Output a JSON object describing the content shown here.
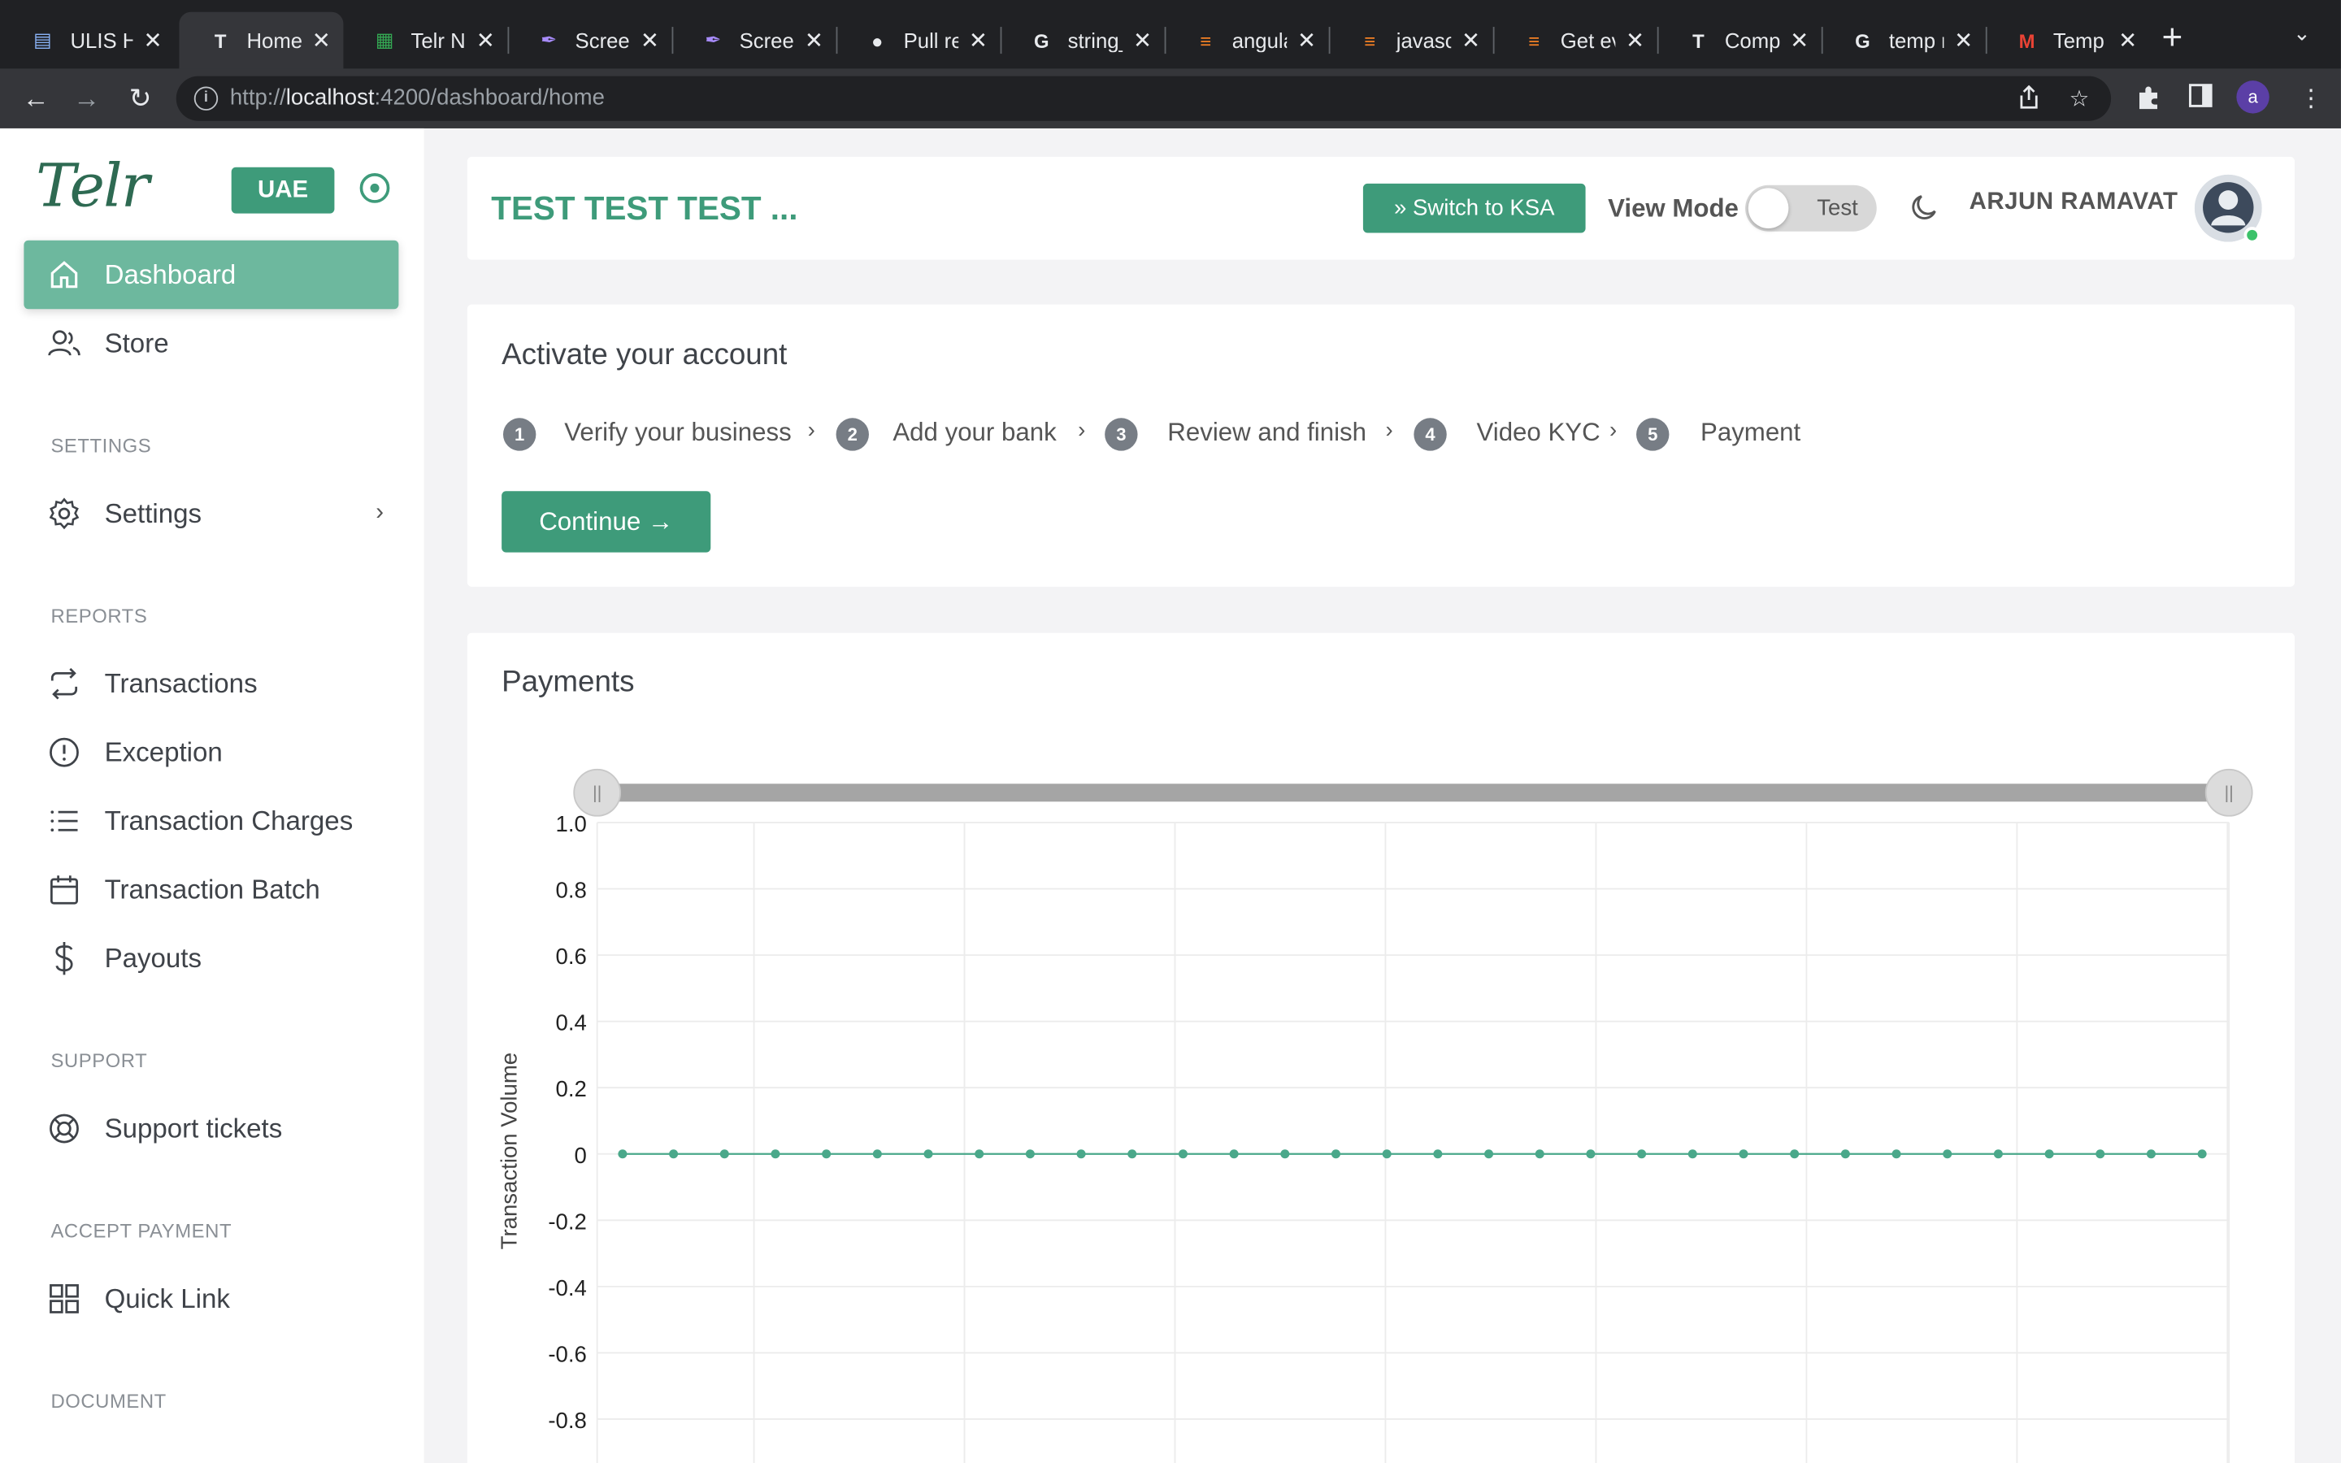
{
  "browser": {
    "tabs": [
      {
        "label": "ULIS H",
        "icon": "document-icon"
      },
      {
        "label": "Home",
        "icon": "telr-icon",
        "active": true
      },
      {
        "label": "Telr Ne",
        "icon": "sheets-icon"
      },
      {
        "label": "Screen",
        "icon": "feather-icon"
      },
      {
        "label": "Screen",
        "icon": "feather-icon"
      },
      {
        "label": "Pull re",
        "icon": "github-icon"
      },
      {
        "label": "string_",
        "icon": "google-icon"
      },
      {
        "label": "angula",
        "icon": "stackoverflow-icon"
      },
      {
        "label": "javasc",
        "icon": "stackoverflow-icon"
      },
      {
        "label": "Get ev",
        "icon": "stackoverflow-icon"
      },
      {
        "label": "Compl",
        "icon": "telr-icon"
      },
      {
        "label": "temp r",
        "icon": "google-icon"
      },
      {
        "label": "Temp",
        "icon": "gmail-icon"
      }
    ],
    "url_prefix": "http://",
    "url_host": "localhost",
    "url_path": ":4200/dashboard/home",
    "profile_initial": "a"
  },
  "sidebar": {
    "logo": "Telr",
    "region": "UAE",
    "items": [
      {
        "label": "Dashboard",
        "icon": "home-icon",
        "active": true
      },
      {
        "label": "Store",
        "icon": "users-icon"
      }
    ],
    "sections": [
      {
        "title": "SETTINGS",
        "items": [
          {
            "label": "Settings",
            "icon": "gear-icon",
            "has_chevron": true
          }
        ]
      },
      {
        "title": "REPORTS",
        "items": [
          {
            "label": "Transactions",
            "icon": "repeat-icon"
          },
          {
            "label": "Exception",
            "icon": "alert-circle-icon"
          },
          {
            "label": "Transaction Charges",
            "icon": "list-icon"
          },
          {
            "label": "Transaction Batch",
            "icon": "calendar-icon"
          },
          {
            "label": "Payouts",
            "icon": "dollar-icon"
          }
        ]
      },
      {
        "title": "SUPPORT",
        "items": [
          {
            "label": "Support tickets",
            "icon": "lifebuoy-icon"
          }
        ]
      },
      {
        "title": "ACCEPT PAYMENT",
        "items": [
          {
            "label": "Quick Link",
            "icon": "grid-icon"
          }
        ]
      },
      {
        "title": "DOCUMENT",
        "items": []
      }
    ]
  },
  "header": {
    "title": "TEST TEST TEST ...",
    "switch_label": "Switch to KSA",
    "view_mode_label": "View Mode",
    "toggle_state": "Test",
    "user_name": "ARJUN RAMAVAT"
  },
  "activate": {
    "title": "Activate your account",
    "steps": [
      {
        "num": "1",
        "label": "Verify your business"
      },
      {
        "num": "2",
        "label": "Add your bank"
      },
      {
        "num": "3",
        "label": "Review and finish"
      },
      {
        "num": "4",
        "label": "Video KYC"
      },
      {
        "num": "5",
        "label": "Payment"
      }
    ],
    "continue_label": "Continue"
  },
  "payments": {
    "title": "Payments"
  },
  "colors": {
    "accent": "#3e9b7a",
    "active_nav": "#6db89e",
    "line": "#4aa88a"
  },
  "chart_data": {
    "type": "line",
    "title": "",
    "ylabel": "Transaction Volume",
    "xlabel": "",
    "ylim": [
      -0.8,
      1.0
    ],
    "y_ticks": [
      "1.0",
      "0.8",
      "0.6",
      "0.4",
      "0.2",
      "0",
      "-0.2",
      "-0.4",
      "-0.6",
      "-0.8"
    ],
    "series": [
      {
        "values": [
          0,
          0,
          0,
          0,
          0,
          0,
          0,
          0,
          0,
          0,
          0,
          0,
          0,
          0,
          0,
          0,
          0,
          0,
          0,
          0,
          0,
          0,
          0,
          0,
          0,
          0,
          0,
          0,
          0,
          0,
          0,
          0
        ]
      }
    ],
    "grid": true,
    "has_range_slider": true
  }
}
